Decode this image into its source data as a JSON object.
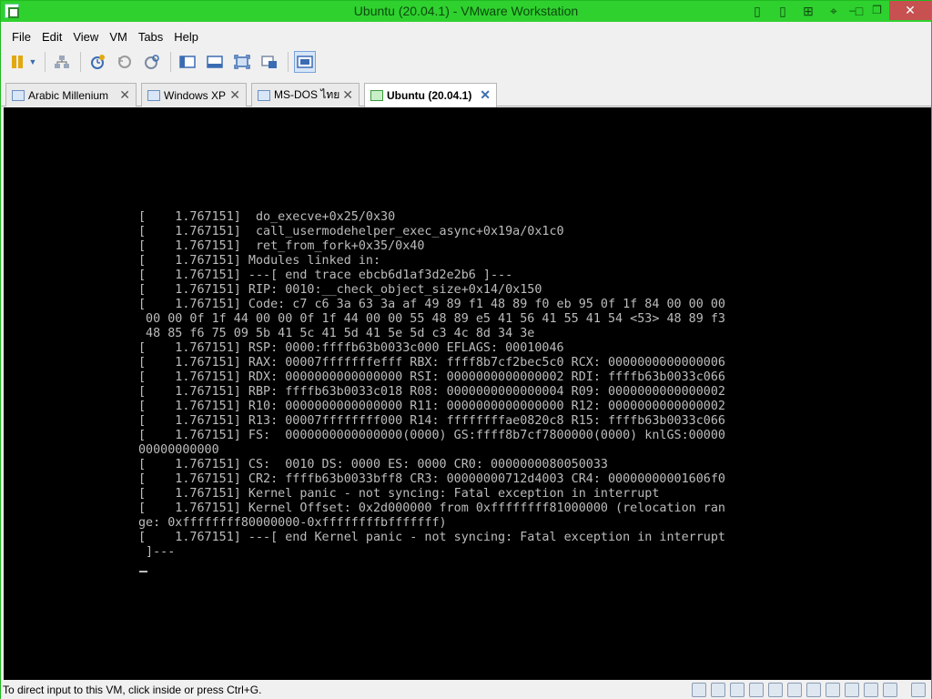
{
  "window": {
    "title": "Ubuntu (20.04.1) - VMware Workstation",
    "title_controls": [
      "▯",
      "▯",
      "⊞",
      "⌖",
      "□"
    ],
    "minimize": "–",
    "maximize": "❐",
    "close": "✕"
  },
  "menu": {
    "items": [
      "File",
      "Edit",
      "View",
      "VM",
      "Tabs",
      "Help"
    ]
  },
  "tabs": [
    {
      "label": "Arabic Millenium",
      "close": "✕"
    },
    {
      "label": "Windows XP",
      "close": "✕"
    },
    {
      "label": "MS-DOS ไทย",
      "close": "✕"
    },
    {
      "label": "Ubuntu (20.04.1)",
      "close": "✕"
    }
  ],
  "console": {
    "lines": [
      "[    1.767151]  do_execve+0x25/0x30",
      "[    1.767151]  call_usermodehelper_exec_async+0x19a/0x1c0",
      "[    1.767151]  ret_from_fork+0x35/0x40",
      "[    1.767151] Modules linked in:",
      "[    1.767151] ---[ end trace ebcb6d1af3d2e2b6 ]---",
      "[    1.767151] RIP: 0010:__check_object_size+0x14/0x150",
      "[    1.767151] Code: c7 c6 3a 63 3a af 49 89 f1 48 89 f0 eb 95 0f 1f 84 00 00 00",
      " 00 00 0f 1f 44 00 00 0f 1f 44 00 00 55 48 89 e5 41 56 41 55 41 54 <53> 48 89 f3",
      " 48 85 f6 75 09 5b 41 5c 41 5d 41 5e 5d c3 4c 8d 34 3e",
      "[    1.767151] RSP: 0000:ffffb63b0033c000 EFLAGS: 00010046",
      "[    1.767151] RAX: 00007fffffffefff RBX: ffff8b7cf2bec5c0 RCX: 0000000000000006",
      "[    1.767151] RDX: 0000000000000000 RSI: 0000000000000002 RDI: ffffb63b0033c066",
      "[    1.767151] RBP: ffffb63b0033c018 R08: 0000000000000004 R09: 0000000000000002",
      "[    1.767151] R10: 0000000000000000 R11: 0000000000000000 R12: 0000000000000002",
      "[    1.767151] R13: 00007ffffffff000 R14: ffffffffae0820c8 R15: ffffb63b0033c066",
      "[    1.767151] FS:  0000000000000000(0000) GS:ffff8b7cf7800000(0000) knlGS:00000",
      "00000000000",
      "[    1.767151] CS:  0010 DS: 0000 ES: 0000 CR0: 0000000080050033",
      "[    1.767151] CR2: ffffb63b0033bff8 CR3: 00000000712d4003 CR4: 00000000001606f0",
      "[    1.767151] Kernel panic - not syncing: Fatal exception in interrupt",
      "[    1.767151] Kernel Offset: 0x2d000000 from 0xffffffff81000000 (relocation ran",
      "ge: 0xffffffff80000000-0xffffffffbfffffff)",
      "[    1.767151] ---[ end Kernel panic - not syncing: Fatal exception in interrupt",
      " ]---"
    ]
  },
  "status": {
    "text": "To direct input to this VM, click inside or press Ctrl+G."
  },
  "colors": {
    "titlebar": "#2fd12f",
    "console_bg": "#000000",
    "console_text": "#bcbcbc"
  }
}
